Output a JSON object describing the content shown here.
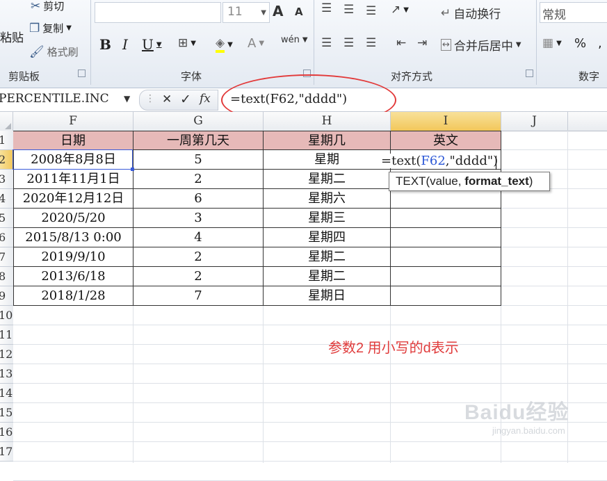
{
  "ribbon": {
    "clipboard": {
      "paste": "粘贴",
      "cut": "剪切",
      "copy": "复制",
      "format_painter": "格式刷",
      "label": "剪贴板"
    },
    "font": {
      "size": "11",
      "grow": "A",
      "shrink": "A",
      "bold": "B",
      "italic": "I",
      "underline": "U",
      "font_color": "A",
      "phonetic": "wén",
      "label": "字体"
    },
    "alignment": {
      "wrap_text": "自动换行",
      "merge_center": "合并后居中",
      "label": "对齐方式"
    },
    "number": {
      "format": "常规",
      "percent": "%",
      "comma": ",",
      "label": "数字"
    }
  },
  "formula_bar": {
    "name_box": "PERCENTILE.INC",
    "cancel": "✕",
    "enter": "✓",
    "fx": "fx",
    "formula": "=text(F62,\"dddd\")"
  },
  "columns": [
    "F",
    "G",
    "H",
    "I",
    "J"
  ],
  "selected_column": "I",
  "rows": [
    "1",
    "2",
    "3",
    "4",
    "5",
    "6",
    "7",
    "8",
    "9",
    "10",
    "11",
    "12",
    "13",
    "14",
    "15",
    "16",
    "17"
  ],
  "selected_row": "2",
  "table": {
    "headers": [
      "日期",
      "一周第几天",
      "星期几",
      "英文"
    ],
    "dates": [
      "2008年8月8日",
      "2011年11月1日",
      "2020年12月12日",
      "2020/5/20",
      "2015/8/13  0:00",
      "2019/9/10",
      "2013/6/18",
      "2018/1/28"
    ],
    "weekday_num": [
      "5",
      "2",
      "6",
      "3",
      "4",
      "2",
      "2",
      "7"
    ],
    "weekday_cn": [
      "星期",
      "星期二",
      "星期六",
      "星期三",
      "星期四",
      "星期二",
      "星期二",
      "星期日"
    ]
  },
  "editing_cell": {
    "prefix": "=text(",
    "ref": "F62",
    "suffix": ",\"dddd\")"
  },
  "tooltip": {
    "func": "TEXT(value, ",
    "arg": "format_text",
    "close": ")"
  },
  "annotation": "参数2 用小写的d表示",
  "watermark": {
    "brand": "Baidu经验",
    "url": "jingyan.baidu.com"
  },
  "colors": {
    "header_fill": "#e6b9b8",
    "annotation": "#e03c3c",
    "selected_header": "#f2c75a"
  }
}
